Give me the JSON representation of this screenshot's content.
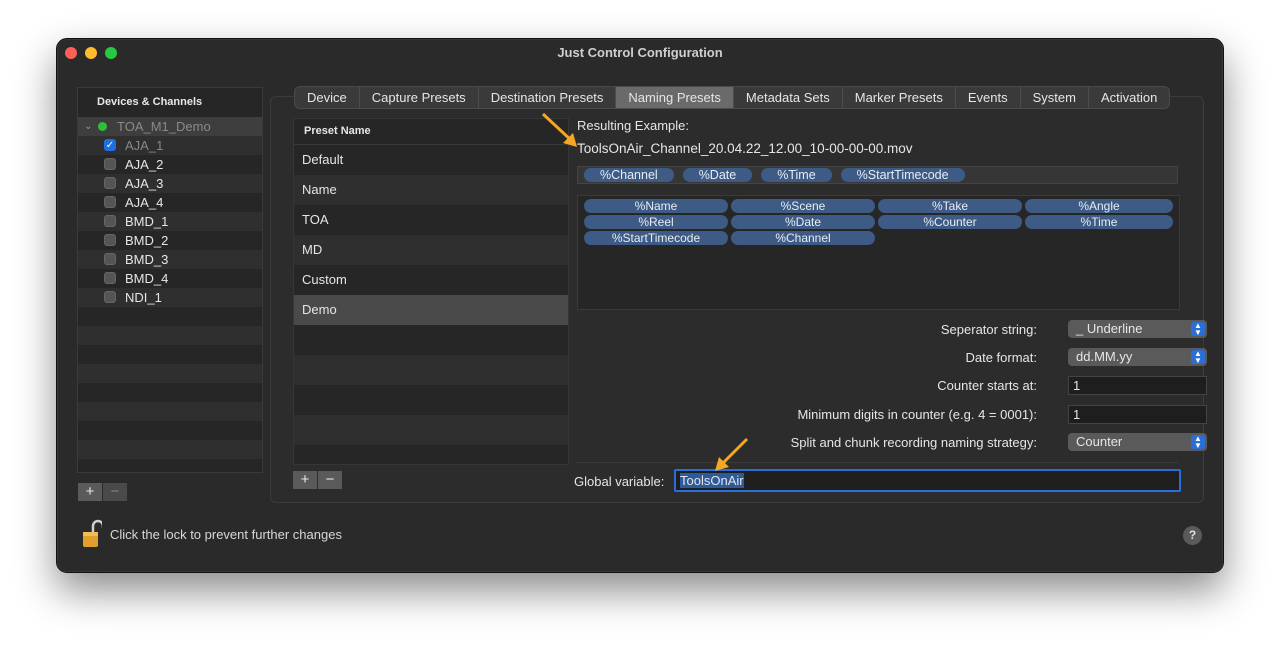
{
  "window": {
    "title": "Just Control Configuration"
  },
  "devices": {
    "header": "Devices & Channels",
    "group": "TOA_M1_Demo",
    "channels": [
      {
        "label": "AJA_1",
        "checked": true
      },
      {
        "label": "AJA_2",
        "checked": false
      },
      {
        "label": "AJA_3",
        "checked": false
      },
      {
        "label": "AJA_4",
        "checked": false
      },
      {
        "label": "BMD_1",
        "checked": false
      },
      {
        "label": "BMD_2",
        "checked": false
      },
      {
        "label": "BMD_3",
        "checked": false
      },
      {
        "label": "BMD_4",
        "checked": false
      },
      {
        "label": "NDI_1",
        "checked": false
      }
    ],
    "add_label": "+",
    "remove_label": "−"
  },
  "tabs": [
    "Device",
    "Capture Presets",
    "Destination Presets",
    "Naming Presets",
    "Metadata Sets",
    "Marker Presets",
    "Events",
    "System",
    "Activation"
  ],
  "active_tab": "Naming Presets",
  "presets": {
    "header": "Preset Name",
    "items": [
      "Default",
      "Name",
      "TOA",
      "MD",
      "Custom",
      "Demo"
    ],
    "selected": "Demo",
    "add_label": "+",
    "remove_label": "−"
  },
  "naming": {
    "result_label": "Resulting Example:",
    "result_value": "ToolsOnAir_Channel_20.04.22_12.00_10-00-00-00.mov",
    "active_tokens": [
      "%Channel",
      "%Date",
      "%Time",
      "%StartTimecode"
    ],
    "available_tokens": [
      "%Name",
      "%Scene",
      "%Take",
      "%Angle",
      "%Reel",
      "%Date",
      "%Counter",
      "%Time",
      "%StartTimecode",
      "%Channel"
    ],
    "separator_label": "Seperator string:",
    "separator_value": "_ Underline",
    "date_format_label": "Date format:",
    "date_format_value": "dd.MM.yy",
    "counter_start_label": "Counter starts at:",
    "counter_start_value": "1",
    "min_digits_label": "Minimum digits in counter (e.g. 4 = 0001):",
    "min_digits_value": "1",
    "split_label": "Split and chunk recording naming strategy:",
    "split_value": "Counter",
    "global_var_label": "Global variable:",
    "global_var_value": "ToolsOnAir"
  },
  "footer": {
    "lock_text": "Click the lock to prevent further changes",
    "help_label": "?"
  },
  "colors": {
    "accent": "#2a6fd8",
    "token": "#3d5b85",
    "annotation": "#f5a623"
  }
}
